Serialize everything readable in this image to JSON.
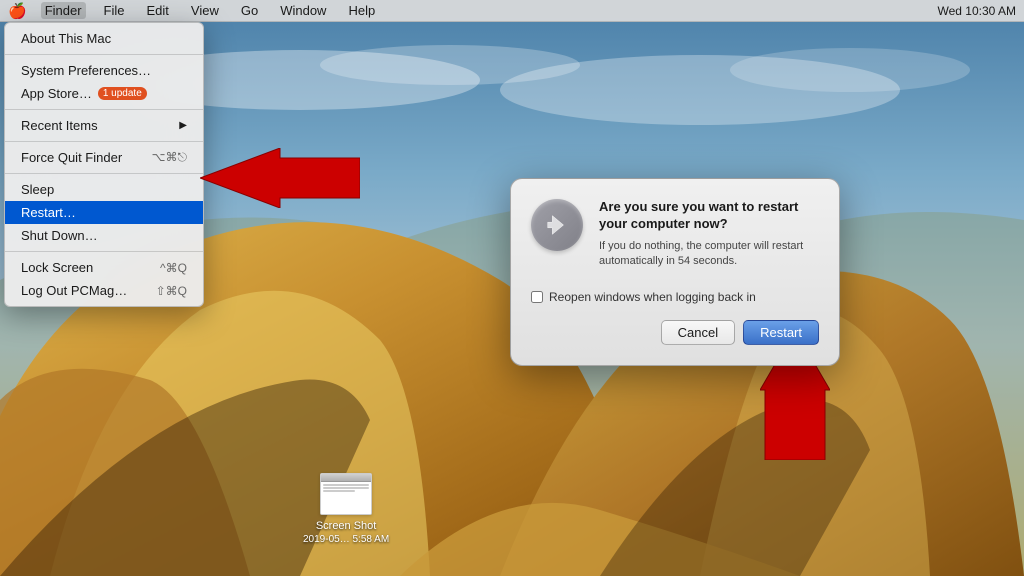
{
  "menubar": {
    "apple": "🍎",
    "items": [
      "Finder",
      "File",
      "Edit",
      "View",
      "Go",
      "Window",
      "Help"
    ],
    "active_item": "Finder",
    "right_items": [
      "Wed 10:30 AM"
    ]
  },
  "apple_menu": {
    "items": [
      {
        "id": "about",
        "label": "About This Mac",
        "shortcut": "",
        "separator_after": false
      },
      {
        "id": "separator1",
        "type": "separator"
      },
      {
        "id": "system_prefs",
        "label": "System Preferences…",
        "shortcut": ""
      },
      {
        "id": "app_store",
        "label": "App Store…",
        "badge": "1 update",
        "separator_after": false
      },
      {
        "id": "separator2",
        "type": "separator"
      },
      {
        "id": "recent_items",
        "label": "Recent Items",
        "arrow": "▶",
        "separator_after": false
      },
      {
        "id": "separator3",
        "type": "separator"
      },
      {
        "id": "force_quit",
        "label": "Force Quit Finder",
        "shortcut": "⌥⌘⎋"
      },
      {
        "id": "separator4",
        "type": "separator"
      },
      {
        "id": "sleep",
        "label": "Sleep",
        "shortcut": ""
      },
      {
        "id": "restart",
        "label": "Restart…",
        "shortcut": "",
        "highlighted": true
      },
      {
        "id": "shutdown",
        "label": "Shut Down…",
        "shortcut": ""
      },
      {
        "id": "separator5",
        "type": "separator"
      },
      {
        "id": "lock",
        "label": "Lock Screen",
        "shortcut": "^⌘Q"
      },
      {
        "id": "logout",
        "label": "Log Out PCMag…",
        "shortcut": "⇧⌘Q"
      }
    ]
  },
  "dialog": {
    "title": "Are you sure you want to restart your computer now?",
    "body": "If you do nothing, the computer will restart automatically in 54 seconds.",
    "checkbox_label": "Reopen windows when logging back in",
    "checkbox_checked": false,
    "cancel_button": "Cancel",
    "restart_button": "Restart"
  },
  "desktop_icon": {
    "label": "Screen Shot",
    "sublabel": "2019-05… 5:58 AM"
  }
}
